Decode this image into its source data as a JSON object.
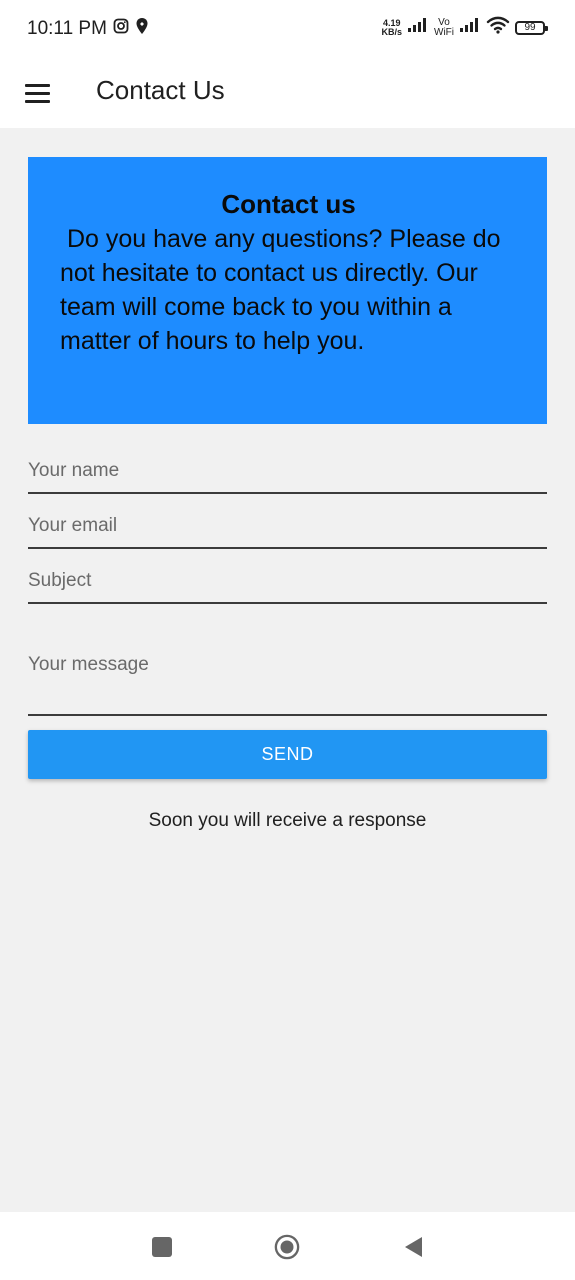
{
  "status_bar": {
    "time": "10:11 PM",
    "speed_value": "4.19",
    "speed_unit": "KB/s",
    "vo_label": "Vo",
    "wifi_label": "WiFi",
    "battery": "99",
    "icons": [
      "instagram-icon",
      "location-icon",
      "signal-icon",
      "signal-icon",
      "wifi-icon",
      "battery-icon"
    ]
  },
  "app_bar": {
    "title": "Contact Us",
    "menu_icon": "hamburger-menu-icon"
  },
  "info_card": {
    "title": "Contact us",
    "body": " Do you have any questions? Please do not hesitate to contact us directly. Our team will come back to you within a matter of hours to help you.",
    "background": "#1e8cff"
  },
  "form": {
    "name_placeholder": "Your name",
    "email_placeholder": "Your email",
    "subject_placeholder": "Subject",
    "message_placeholder": "Your message",
    "send_label": "SEND",
    "button_color": "#2196f3"
  },
  "response_text": "Soon you will receive a response",
  "nav_bar": {
    "icons": [
      "recents-square-icon",
      "home-circle-icon",
      "back-triangle-icon"
    ]
  }
}
